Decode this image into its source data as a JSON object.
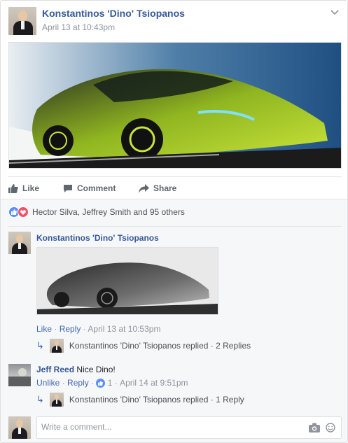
{
  "post": {
    "author": "Konstantinos 'Dino' Tsiopanos",
    "timestamp": "April 13 at 10:43pm",
    "menu_icon": "chevron-down-icon"
  },
  "actions": {
    "like": "Like",
    "comment": "Comment",
    "share": "Share"
  },
  "reactions": {
    "text": "Hector Silva, Jeffrey Smith and 95 others",
    "types": [
      "like",
      "love"
    ],
    "colors": {
      "like": "#5890ff",
      "love": "#f25268"
    }
  },
  "comments": [
    {
      "author": "Konstantinos 'Dino' Tsiopanos",
      "text": "",
      "like": "Like",
      "reply": "Reply",
      "time": "April 13 at 10:53pm",
      "replies_summary": {
        "name": "Konstantinos 'Dino' Tsiopanos",
        "action": "replied",
        "count": "2 Replies"
      }
    },
    {
      "author": "Jeff Reed",
      "text": "Nice Dino!",
      "like": "Unlike",
      "reply": "Reply",
      "like_count": "1",
      "time": "April 14 at 9:51pm",
      "replies_summary": {
        "name": "Konstantinos 'Dino' Tsiopanos",
        "action": "replied",
        "count": "1 Reply"
      }
    }
  ],
  "write_comment": {
    "placeholder": "Write a comment...",
    "icons": [
      "camera-icon",
      "emoji-icon"
    ]
  },
  "colors": {
    "link": "#365899",
    "accent": "#4267b2",
    "muted": "#90949c",
    "car_accent": "#a8d020"
  }
}
